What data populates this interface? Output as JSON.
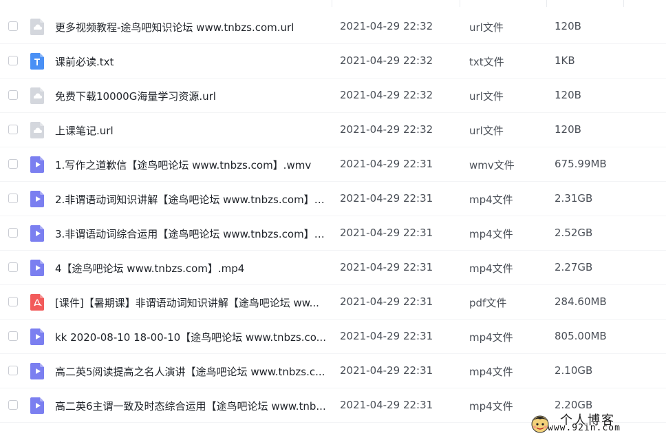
{
  "colors": {
    "doc_gray": "#d4d7dd",
    "txt_blue": "#4a90f5",
    "video_purple": "#7b7ff0",
    "pdf_red": "#f25b5b"
  },
  "files": [
    {
      "icon": "link-file-icon",
      "name": "更多视频教程-途鸟吧知识论坛 www.tnbzs.com.url",
      "date": "2021-04-29 22:32",
      "type": "url文件",
      "size": "120B"
    },
    {
      "icon": "txt-file-icon",
      "name": "课前必读.txt",
      "date": "2021-04-29 22:32",
      "type": "txt文件",
      "size": "1KB"
    },
    {
      "icon": "link-file-icon",
      "name": "免费下载10000G海量学习资源.url",
      "date": "2021-04-29 22:32",
      "type": "url文件",
      "size": "120B"
    },
    {
      "icon": "link-file-icon",
      "name": "上课笔记.url",
      "date": "2021-04-29 22:32",
      "type": "url文件",
      "size": "120B"
    },
    {
      "icon": "video-file-icon",
      "name": "1.写作之道歉信【途鸟吧论坛 www.tnbzs.com】.wmv",
      "date": "2021-04-29 22:31",
      "type": "wmv文件",
      "size": "675.99MB"
    },
    {
      "icon": "video-file-icon",
      "name": "2.非谓语动词知识讲解【途鸟吧论坛 www.tnbzs.com】....",
      "date": "2021-04-29 22:31",
      "type": "mp4文件",
      "size": "2.31GB"
    },
    {
      "icon": "video-file-icon",
      "name": "3.非谓语动词综合运用【途鸟吧论坛 www.tnbzs.com】....",
      "date": "2021-04-29 22:31",
      "type": "mp4文件",
      "size": "2.52GB"
    },
    {
      "icon": "video-file-icon",
      "name": "4【途鸟吧论坛 www.tnbzs.com】.mp4",
      "date": "2021-04-29 22:31",
      "type": "mp4文件",
      "size": "2.27GB"
    },
    {
      "icon": "pdf-file-icon",
      "name": "[课件]【暑期课】非谓语动词知识讲解【途鸟吧论坛 ww...",
      "date": "2021-04-29 22:31",
      "type": "pdf文件",
      "size": "284.60MB"
    },
    {
      "icon": "video-file-icon",
      "name": "kk 2020-08-10 18-00-10【途鸟吧论坛 www.tnbzs.co...",
      "date": "2021-04-29 22:31",
      "type": "mp4文件",
      "size": "805.00MB"
    },
    {
      "icon": "video-file-icon",
      "name": "高二英5阅读提高之名人演讲【途鸟吧论坛 www.tnbzs.c...",
      "date": "2021-04-29 22:31",
      "type": "mp4文件",
      "size": "2.10GB"
    },
    {
      "icon": "video-file-icon",
      "name": "高二英6主谓一致及时态综合运用【途鸟吧论坛 www.tnb...",
      "date": "2021-04-29 22:31",
      "type": "mp4文件",
      "size": "2.20GB"
    }
  ],
  "watermark": {
    "title": "个人博客",
    "url": "www.92in.com"
  }
}
